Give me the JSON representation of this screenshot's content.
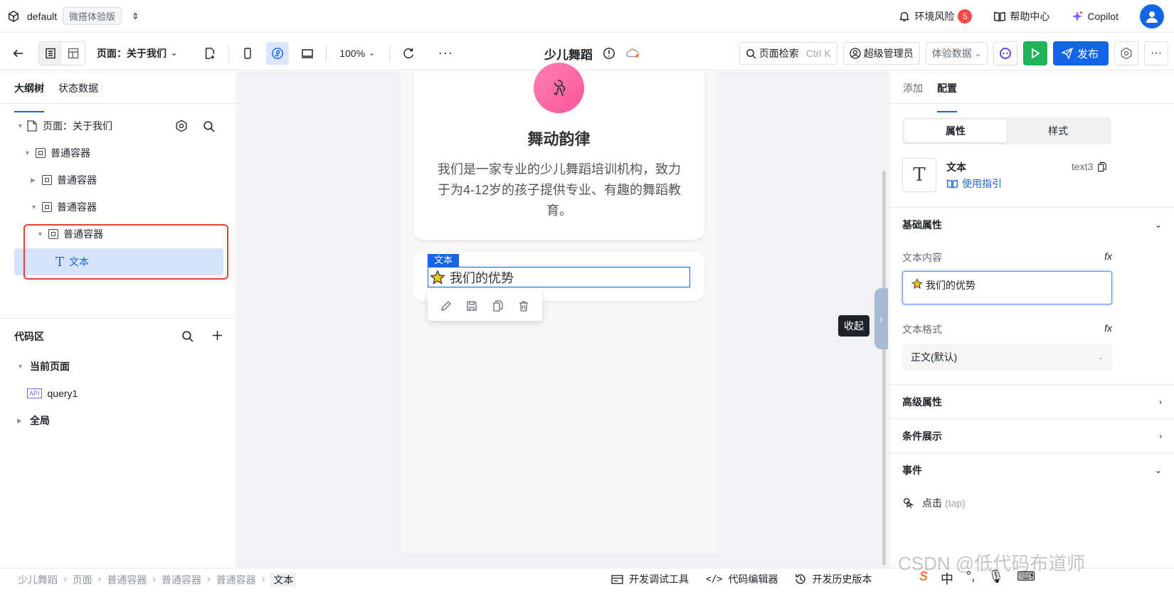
{
  "topbar": {
    "env_name": "default",
    "edition": "微搭体验版",
    "env_risk_label": "环境风险",
    "env_risk_count": "5",
    "help_label": "帮助中心",
    "copilot_label": "Copilot"
  },
  "toolbar": {
    "page_select": "页面：关于我们",
    "zoom": "100%",
    "app_title": "少儿舞蹈",
    "search_label": "页面检索",
    "search_hint": "Ctrl K",
    "admin_label": "超级管理员",
    "data_label": "体验数据",
    "publish_label": "发布"
  },
  "left": {
    "tabs": [
      "大纲树",
      "状态数据"
    ],
    "tree": [
      {
        "label": "页面：关于我们"
      },
      {
        "label": "普通容器"
      },
      {
        "label": "普通容器"
      },
      {
        "label": "普通容器"
      },
      {
        "label": "普通容器"
      },
      {
        "label": "文本"
      }
    ],
    "code_title": "代码区",
    "code_tree": {
      "current_page": "当前页面",
      "query": "query1",
      "global": "全局"
    }
  },
  "canvas": {
    "brand_title": "舞动韵律",
    "brand_desc": "我们是一家专业的少儿舞蹈培训机构，致力于为4-12岁的孩子提供专业、有趣的舞蹈教育。",
    "selected_label": "文本",
    "selected_text": "我们的优势",
    "collapse_tip": "收起"
  },
  "right": {
    "tabs": [
      "添加",
      "配置"
    ],
    "segments": [
      "属性",
      "样式"
    ],
    "component_name": "文本",
    "component_id": "text3",
    "guide_label": "使用指引",
    "basic_section": "基础属性",
    "text_content_label": "文本内容",
    "text_content_value": "我们的优势",
    "text_format_label": "文本格式",
    "text_format_value": "正文(默认)",
    "advanced_section": "高级属性",
    "condition_section": "条件展示",
    "events_section": "事件",
    "event_item": "点击",
    "event_item_code": "(tap)",
    "fx_label": "fx"
  },
  "statusbar": {
    "crumbs": [
      "少儿舞蹈",
      "页面",
      "普通容器",
      "普通容器",
      "普通容器",
      "文本"
    ],
    "devtools_label": "开发调试工具",
    "code_editor_label": "代码编辑器",
    "history_label": "开发历史版本",
    "ime_lang": "中"
  },
  "watermark": "CSDN @低代码布道师",
  "colors": {
    "primary": "#1464e6",
    "run_green": "#20b35a",
    "danger": "#f54a45",
    "highlight_border": "#e0413b"
  }
}
